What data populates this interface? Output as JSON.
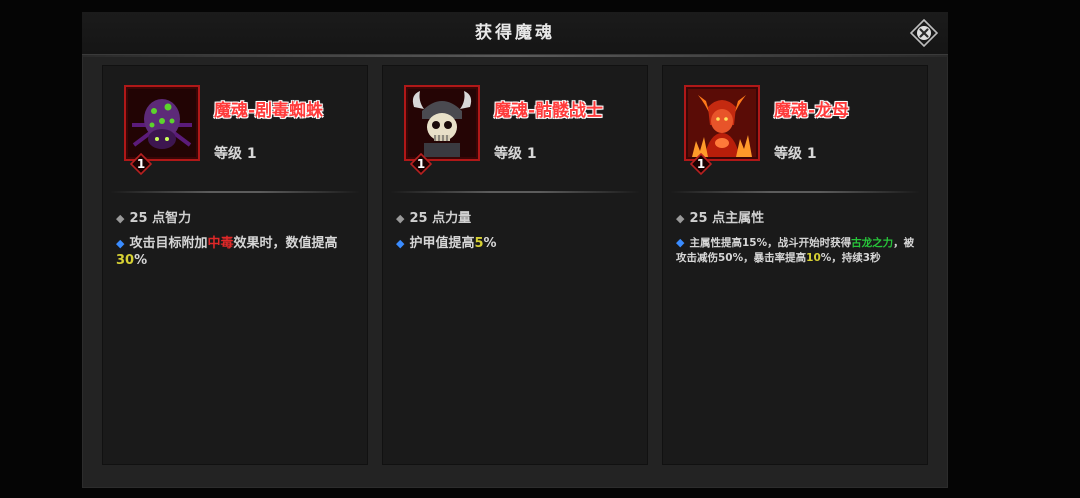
{
  "dialog": {
    "title": "获得魔魂",
    "close_icon": "close-icon"
  },
  "cards": [
    {
      "name": "魔魂-剧毒蜘蛛",
      "level": "等级 1",
      "badge": "1",
      "portrait_icon": "poison-spider-icon",
      "stat": "25 点智力",
      "effect": {
        "t1": "攻击目标附加",
        "t2": "中毒",
        "t3": "效果时，数值提高",
        "t4": "30",
        "t5": "%"
      }
    },
    {
      "name": "魔魂-骷髅战士",
      "level": "等级 1",
      "badge": "1",
      "portrait_icon": "skeleton-warrior-icon",
      "stat": "25 点力量",
      "effect": {
        "t1": "护甲值提高",
        "t2": "5",
        "t3": "%"
      }
    },
    {
      "name": "魔魂-龙母",
      "level": "等级 1",
      "badge": "1",
      "portrait_icon": "dragon-mother-icon",
      "stat": "25 点主属性",
      "effect": {
        "t1": "主属性提高15%，战斗开始时获得",
        "t2": "古龙之力",
        "t3": "，被攻击减伤50%，暴击率提高",
        "t4": "10",
        "t5": "%，持续3秒"
      }
    }
  ],
  "colors": {
    "name_red": "#ff3b3b",
    "debuff_red": "#e02828",
    "value_yellow": "#d6d034",
    "buff_green": "#27c43a",
    "bullet_blue": "#3a8cff"
  }
}
